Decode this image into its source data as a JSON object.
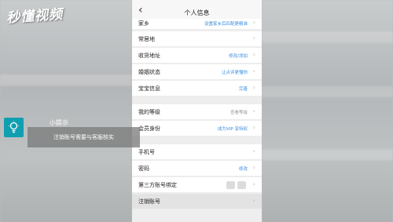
{
  "watermark": "秒懂视频",
  "nav": {
    "back_icon": "chevron-left",
    "title": "个人信息"
  },
  "rows": [
    {
      "label": "家乡",
      "value": "设置家乡后匹配更精准",
      "value_style": "blue"
    },
    {
      "label": "常居地",
      "value": "",
      "value_style": "blue"
    },
    {
      "label": "收货地址",
      "value": "修改/添加",
      "value_style": "blue"
    },
    {
      "label": "婚姻状态",
      "value": "让点评更懂你",
      "value_style": "blue"
    },
    {
      "label": "宝宝信息",
      "value": "完善",
      "value_style": "blue"
    },
    {
      "label": "我的等级",
      "value": "查看等级",
      "value_style": "gray"
    },
    {
      "label": "会员身份",
      "value": "成为VIP 享特权",
      "value_style": "blue"
    },
    {
      "label": "手机号",
      "value": "",
      "value_style": "blue"
    },
    {
      "label": "密码",
      "value": "修改",
      "value_style": "blue"
    },
    {
      "label": "第三方账号绑定",
      "value": "",
      "value_style": "blue"
    },
    {
      "label": "注销账号",
      "value": "",
      "value_style": "blue"
    }
  ],
  "tip": {
    "icon": "lightbulb-icon",
    "title": "小提示",
    "text": "注销账号需要与客服核实"
  },
  "colors": {
    "accent": "#3a8de0",
    "tip_icon_bg": "#0f9fb0"
  }
}
